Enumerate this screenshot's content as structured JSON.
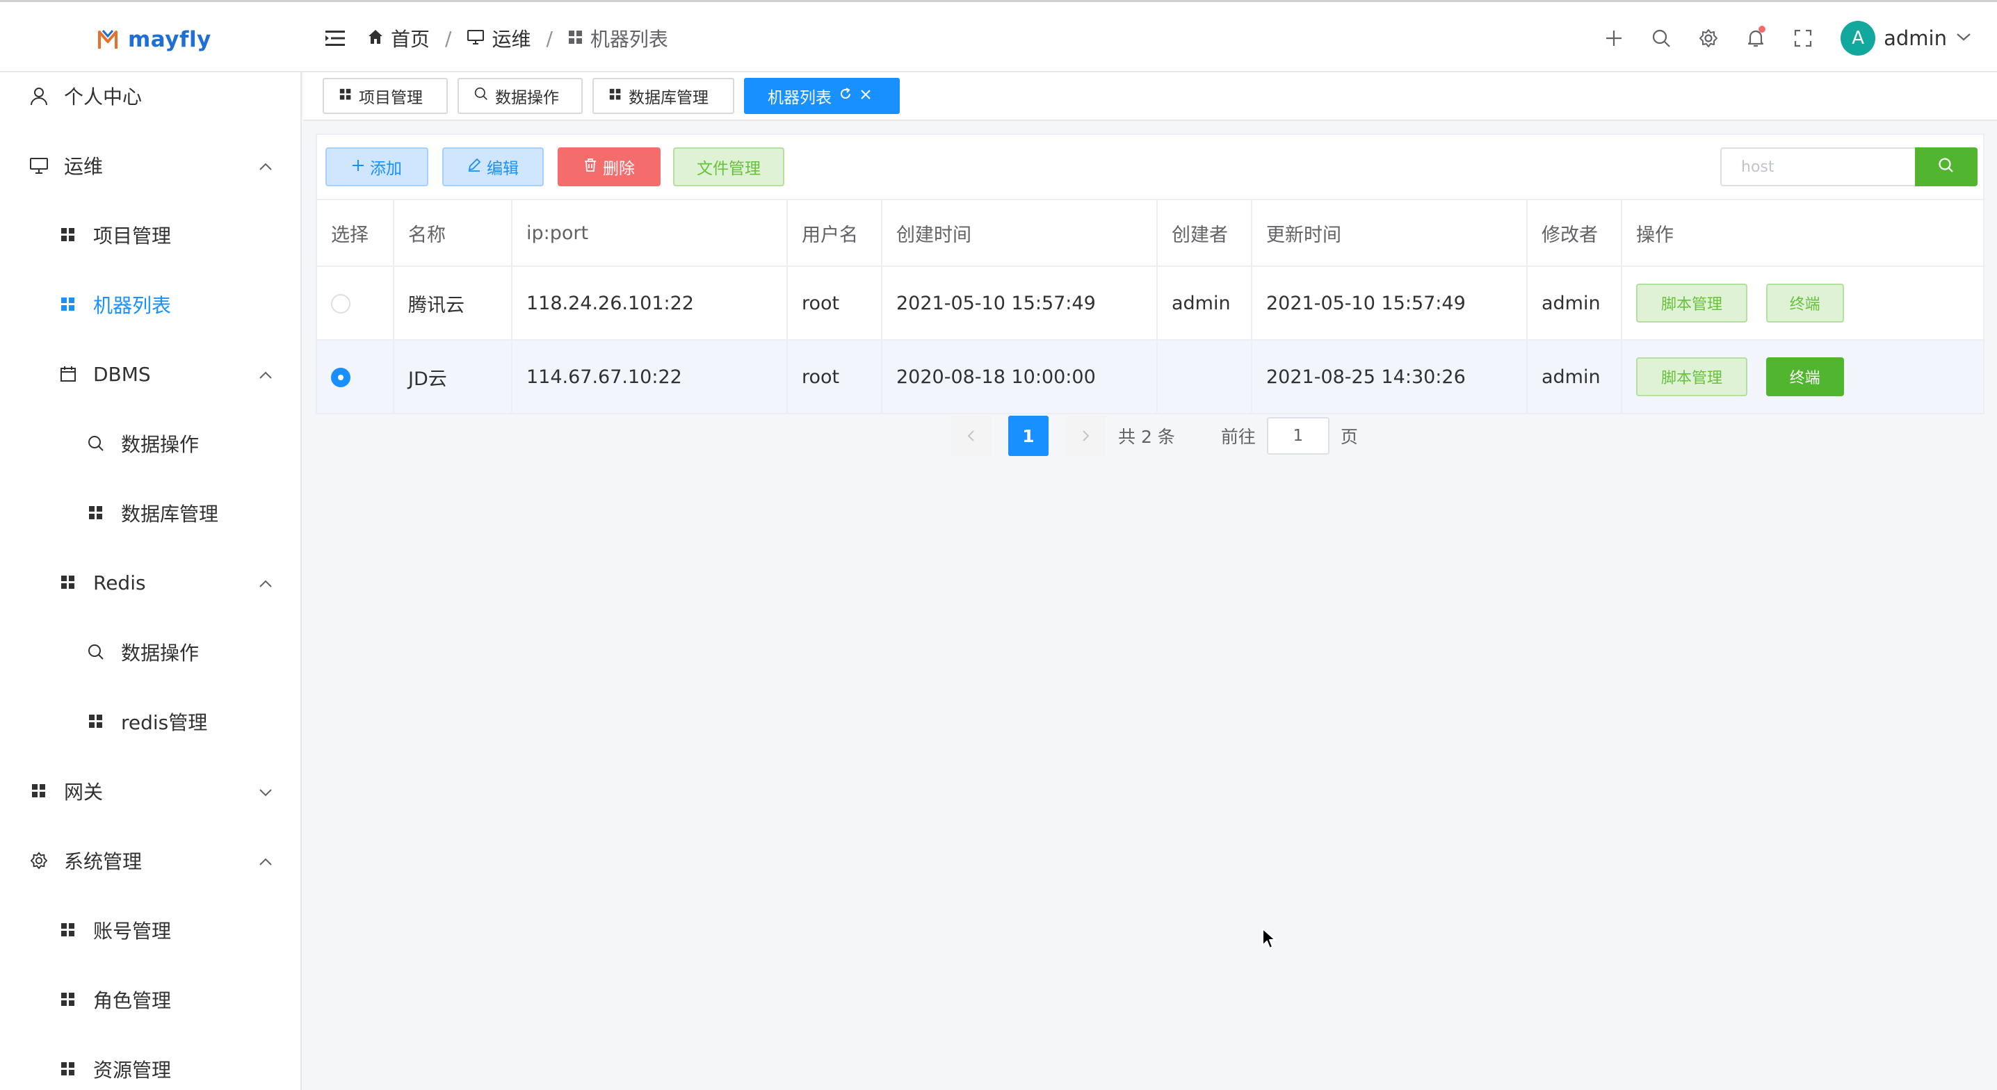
{
  "brand": {
    "name": "mayfly"
  },
  "breadcrumb": {
    "home": "首页",
    "section": "运维",
    "current": "机器列表",
    "separator": "/"
  },
  "header": {
    "username": "admin",
    "avatar_letter": "A"
  },
  "sidebar": {
    "items": [
      {
        "label": "个人中心",
        "icon": "user-icon"
      },
      {
        "label": "运维",
        "icon": "monitor-icon"
      },
      {
        "label": "项目管理",
        "icon": "grid-icon"
      },
      {
        "label": "机器列表",
        "icon": "grid-icon",
        "active": true
      },
      {
        "label": "DBMS",
        "icon": "calendar-icon"
      },
      {
        "label": "数据操作",
        "icon": "search-icon"
      },
      {
        "label": "数据库管理",
        "icon": "grid-icon"
      },
      {
        "label": "Redis",
        "icon": "grid-icon"
      },
      {
        "label": "数据操作",
        "icon": "search-icon"
      },
      {
        "label": "redis管理",
        "icon": "grid-icon"
      },
      {
        "label": "网关",
        "icon": "grid-icon"
      },
      {
        "label": "系统管理",
        "icon": "gear-icon"
      },
      {
        "label": "账号管理",
        "icon": "grid-icon"
      },
      {
        "label": "角色管理",
        "icon": "grid-icon"
      },
      {
        "label": "资源管理",
        "icon": "grid-icon"
      }
    ]
  },
  "tags": [
    {
      "label": "项目管理"
    },
    {
      "label": "数据操作"
    },
    {
      "label": "数据库管理"
    },
    {
      "label": "机器列表",
      "active": true
    }
  ],
  "toolbar": {
    "add_label": "添加",
    "edit_label": "编辑",
    "delete_label": "删除",
    "file_label": "文件管理",
    "search_placeholder": "host"
  },
  "table": {
    "columns": [
      "选择",
      "名称",
      "ip:port",
      "用户名",
      "创建时间",
      "创建者",
      "更新时间",
      "修改者",
      "操作"
    ],
    "rows": [
      {
        "selected": false,
        "name": "腾讯云",
        "ip_port": "118.24.26.101:22",
        "username": "root",
        "created_at": "2021-05-10 15:57:49",
        "creator": "admin",
        "updated_at": "2021-05-10 15:57:49",
        "modifier": "admin",
        "script_label": "脚本管理",
        "terminal_label": "终端"
      },
      {
        "selected": true,
        "name": "JD云",
        "ip_port": "114.67.67.10:22",
        "username": "root",
        "created_at": "2020-08-18 10:00:00",
        "creator": "",
        "updated_at": "2021-08-25 14:30:26",
        "modifier": "admin",
        "script_label": "脚本管理",
        "terminal_label": "终端"
      }
    ]
  },
  "pagination": {
    "current_page": "1",
    "total_text": "共 2 条",
    "goto_label": "前往",
    "goto_value": "1",
    "page_suffix": "页"
  },
  "colors": {
    "primary": "#1890ff",
    "success": "#52b52f",
    "danger": "#f56c6c"
  }
}
